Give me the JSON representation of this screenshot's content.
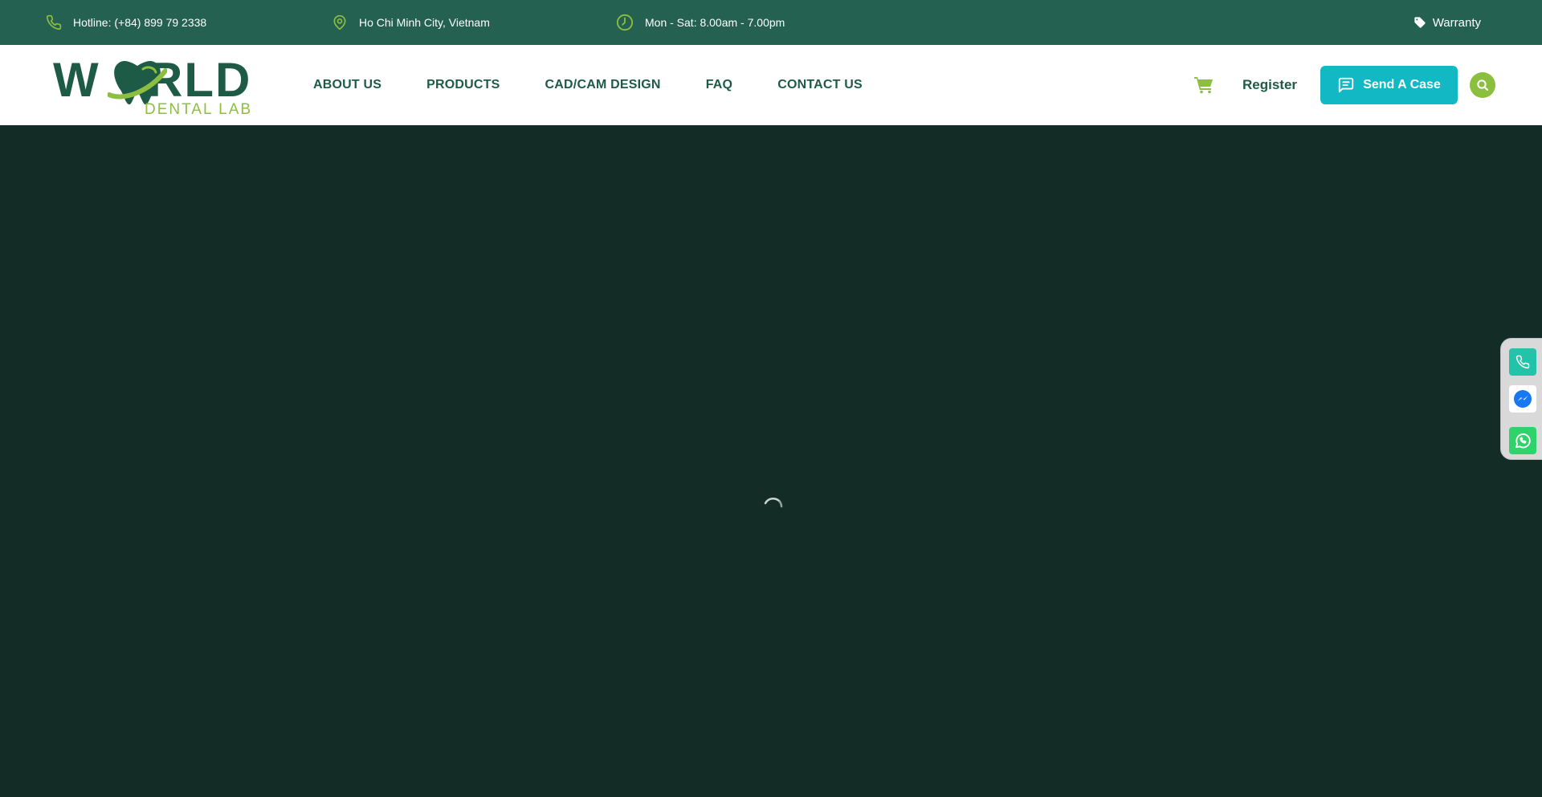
{
  "topbar": {
    "hotline": "Hotline: (+84) 899 79 2338",
    "location": "Ho Chi Minh City, Vietnam",
    "hours": "Mon - Sat: 8.00am - 7.00pm",
    "warranty": "Warranty"
  },
  "logo": {
    "top_w": "W",
    "top_rest": "RLD",
    "bottom": "DENTAL LAB"
  },
  "nav": {
    "items": [
      "ABOUT US",
      "PRODUCTS",
      "CAD/CAM DESIGN",
      "FAQ",
      "CONTACT US"
    ]
  },
  "header": {
    "register": "Register",
    "send_case": "Send A Case"
  },
  "colors": {
    "topbar_bg": "#246150",
    "brand_green": "#1e5b47",
    "accent_lime": "#8cbf3f",
    "button_cyan": "#12b9c4",
    "main_bg": "#132c25"
  },
  "icons": {
    "topbar": [
      "phone-icon",
      "location-pin-icon",
      "clock-icon",
      "tag-icon"
    ],
    "header": [
      "cart-icon",
      "chat-icon",
      "search-icon"
    ],
    "floating": [
      "phone-icon",
      "messenger-icon",
      "whatsapp-icon"
    ]
  }
}
